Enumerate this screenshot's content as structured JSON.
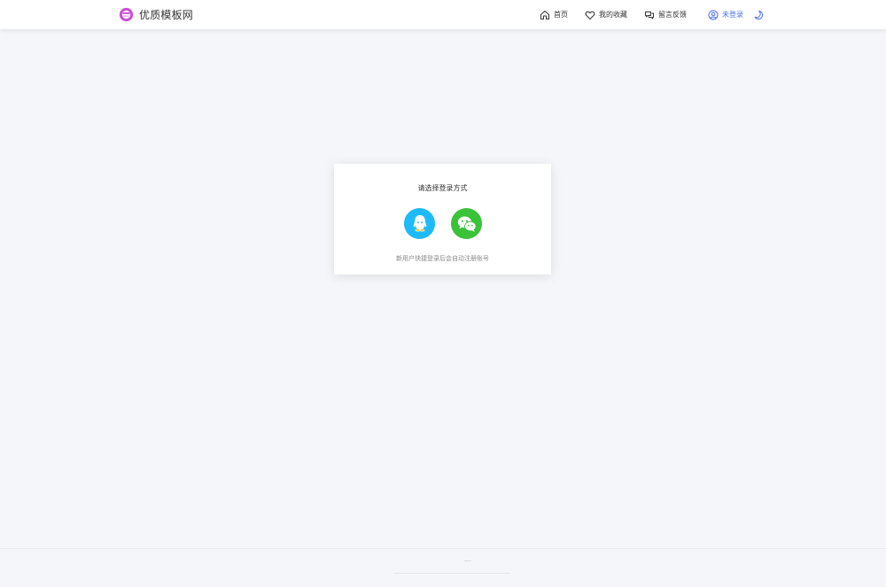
{
  "header": {
    "brand_name": "优质模板网",
    "nav": [
      {
        "label": "首页",
        "icon": "home-icon"
      },
      {
        "label": "我的收藏",
        "icon": "heart-icon"
      },
      {
        "label": "留言反馈",
        "icon": "chat-icon"
      },
      {
        "label": "未登录",
        "icon": "user-icon"
      }
    ],
    "theme_toggle_icon": "moon-icon"
  },
  "login_card": {
    "title": "请选择登录方式",
    "options": [
      {
        "name": "QQ",
        "icon": "qq-icon",
        "color": "#1ebafc"
      },
      {
        "name": "WeChat",
        "icon": "wechat-icon",
        "color": "#3ac239"
      }
    ],
    "note": "新用户快捷登录后会自动注册账号"
  },
  "colors": {
    "accent": "#4c6ef5",
    "brand": "#c94fd8",
    "background": "#f4f6fa"
  }
}
